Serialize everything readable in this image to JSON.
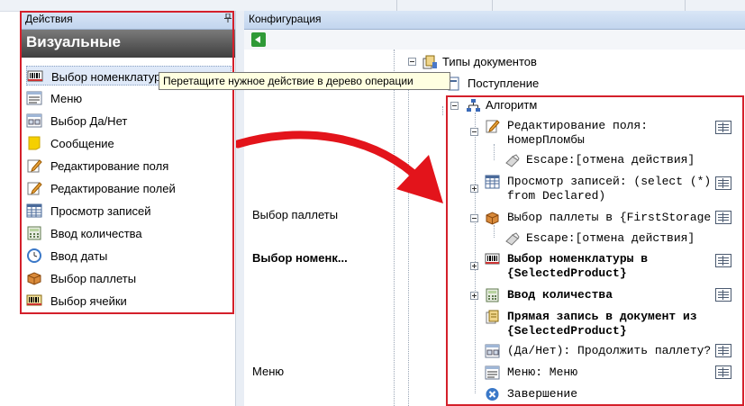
{
  "left_panel": {
    "header": "Действия",
    "tab": "Визуальные",
    "items": [
      {
        "label": "Выбор номенклатуры",
        "icon": "barcode-scanner-icon"
      },
      {
        "label": "Меню",
        "icon": "menu-list-icon"
      },
      {
        "label": "Выбор Да/Нет",
        "icon": "yes-no-icon"
      },
      {
        "label": "Сообщение",
        "icon": "message-icon"
      },
      {
        "label": "Редактирование поля",
        "icon": "edit-field-icon"
      },
      {
        "label": "Редактирование полей",
        "icon": "edit-fields-icon"
      },
      {
        "label": "Просмотр записей",
        "icon": "records-grid-icon"
      },
      {
        "label": "Ввод количества",
        "icon": "calculator-icon"
      },
      {
        "label": "Ввод даты",
        "icon": "date-icon"
      },
      {
        "label": "Выбор паллеты",
        "icon": "pallet-box-icon"
      },
      {
        "label": "Выбор ячейки",
        "icon": "cell-icon"
      }
    ]
  },
  "tooltip": "Перетащите нужное действие в дерево операции",
  "right_panel": {
    "header": "Конфигурация",
    "tree": {
      "doc_types": "Типы документов",
      "incoming": "Поступление",
      "algorithm": "Алгоритм",
      "nodes": {
        "edit_field_1": "Редактирование поля:",
        "edit_field_2": "НомерПломбы",
        "escape_1": "Escape:[отмена действия]",
        "view_records_1": "Просмотр записей: (select (*)",
        "view_records_2": "from Declared)",
        "pallet_select": "Выбор паллеты в {FirstStorage",
        "escape_2": "Escape:[отмена действия]",
        "product_select_1": "Выбор номенклатуры в",
        "product_select_2": "{SelectedProduct}",
        "quantity": "Ввод количества",
        "direct_write_1": "Прямая запись в документ из",
        "direct_write_2": "{SelectedProduct}",
        "yes_no": "(Да/Нет): Продолжить паллету?",
        "menu": "Меню: Меню",
        "finish": "Завершение"
      }
    },
    "side_labels": {
      "pallet": "Выбор паллеты",
      "product": "Выбор номенк...",
      "menu": "Меню"
    }
  },
  "colors": {
    "highlight_border": "#d4202b",
    "arrow": "#e3141b",
    "header_blue": "#c2d5ee"
  }
}
